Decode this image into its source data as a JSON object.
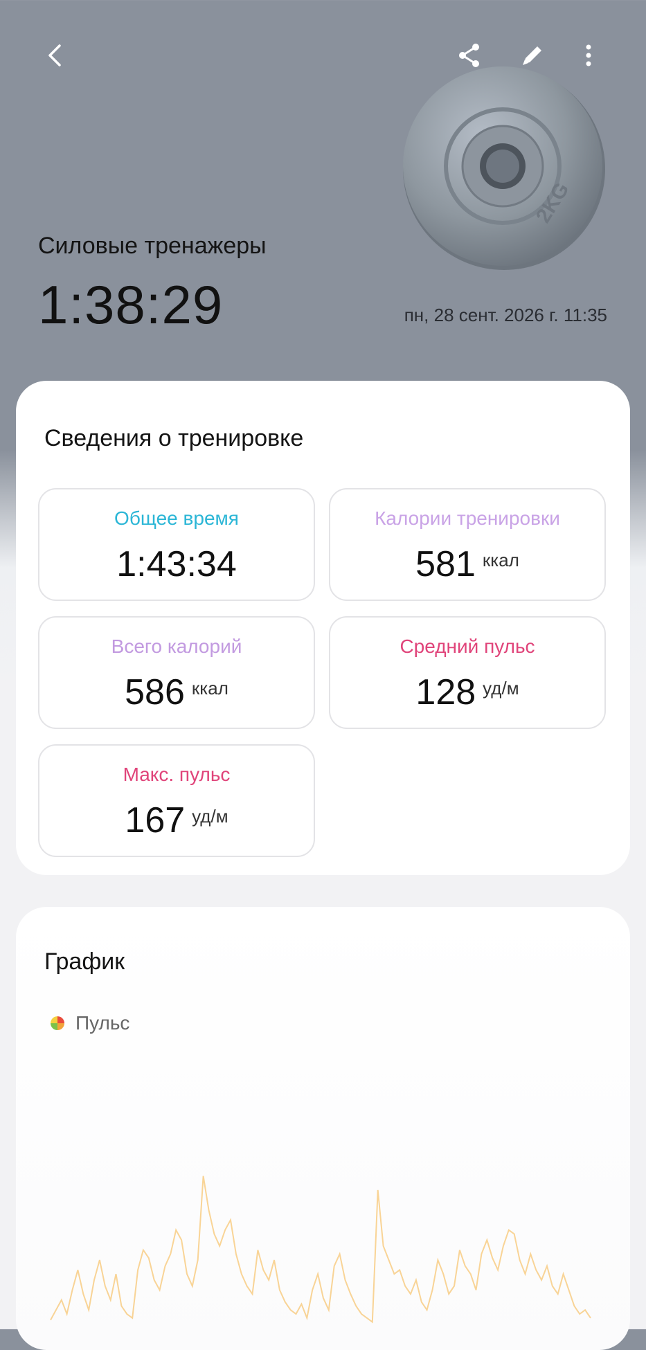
{
  "header": {
    "title": "Силовые тренажеры",
    "duration": "1:38:29",
    "date": "пн, 28 сент. 2026 г. 11:35",
    "plate_marking": "2KG",
    "icons": [
      "back-arrow-icon",
      "share-icon",
      "edit-pencil-icon",
      "more-vertical-icon"
    ]
  },
  "details": {
    "title": "Сведения о тренировке",
    "total_time": {
      "label": "Общее время",
      "value": "1:43:34",
      "color": "#2bb6d6"
    },
    "workout_calories": {
      "label": "Калории тренировки",
      "value": "581",
      "unit": "ккал",
      "color": "#c9a3e6"
    },
    "total_calories": {
      "label": "Всего калорий",
      "value": "586",
      "unit": "ккал",
      "color": "#c29ae0"
    },
    "avg_pulse": {
      "label": "Средний пульс",
      "value": "128",
      "unit": "уд/м",
      "color": "#e0447a"
    },
    "max_pulse": {
      "label": "Макс. пульс",
      "value": "167",
      "unit": "уд/м",
      "color": "#e0447a"
    }
  },
  "chart_section": {
    "title": "График",
    "legend_label": "Пульс"
  },
  "chart_data": {
    "type": "line",
    "series": [
      {
        "name": "Пульс",
        "values": [
          95,
          100,
          105,
          98,
          110,
          120,
          108,
          100,
          115,
          125,
          112,
          105,
          118,
          102,
          98,
          96,
          120,
          130,
          126,
          115,
          110,
          122,
          128,
          140,
          135,
          118,
          112,
          125,
          167,
          150,
          138,
          132,
          140,
          145,
          128,
          118,
          112,
          108,
          130,
          120,
          115,
          125,
          110,
          104,
          100,
          98,
          103,
          96,
          110,
          118,
          106,
          100,
          122,
          128,
          115,
          108,
          102,
          98,
          96,
          94,
          160,
          132,
          125,
          118,
          120,
          112,
          108,
          115,
          104,
          100,
          110,
          125,
          118,
          108,
          112,
          130,
          122,
          118,
          110,
          128,
          135,
          126,
          120,
          132,
          140,
          138,
          125,
          118,
          128,
          120,
          115,
          122,
          112,
          108,
          118,
          110,
          102,
          98,
          100,
          96
        ]
      }
    ],
    "colors": [
      "#f5b342",
      "#ee8a3c",
      "#f7e08a"
    ]
  }
}
